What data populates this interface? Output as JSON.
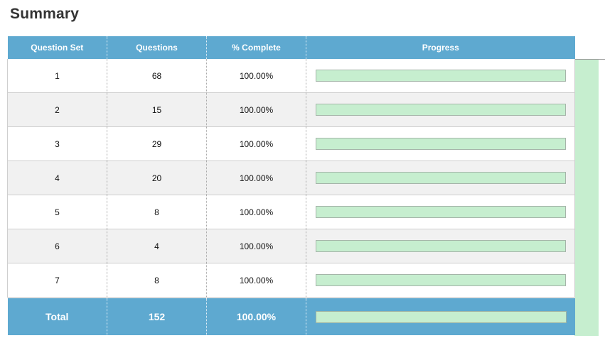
{
  "page": {
    "title": "Summary"
  },
  "table": {
    "headers": [
      "Question Set",
      "Questions",
      "% Complete",
      "Progress"
    ],
    "rows": [
      {
        "set": "1",
        "questions": "68",
        "complete": "100.00%",
        "progress": 1.0
      },
      {
        "set": "2",
        "questions": "15",
        "complete": "100.00%",
        "progress": 1.0
      },
      {
        "set": "3",
        "questions": "29",
        "complete": "100.00%",
        "progress": 1.0
      },
      {
        "set": "4",
        "questions": "20",
        "complete": "100.00%",
        "progress": 1.0
      },
      {
        "set": "5",
        "questions": "8",
        "complete": "100.00%",
        "progress": 1.0
      },
      {
        "set": "6",
        "questions": "4",
        "complete": "100.00%",
        "progress": 1.0
      },
      {
        "set": "7",
        "questions": "8",
        "complete": "100.00%",
        "progress": 1.0
      }
    ],
    "total": {
      "label": "Total",
      "questions": "152",
      "complete": "100.00%",
      "progress": 1.0
    }
  },
  "colors": {
    "header_bg": "#5ea9d0",
    "progress_fill": "#c6eecf",
    "row_alt_bg": "#f1f1f1"
  }
}
